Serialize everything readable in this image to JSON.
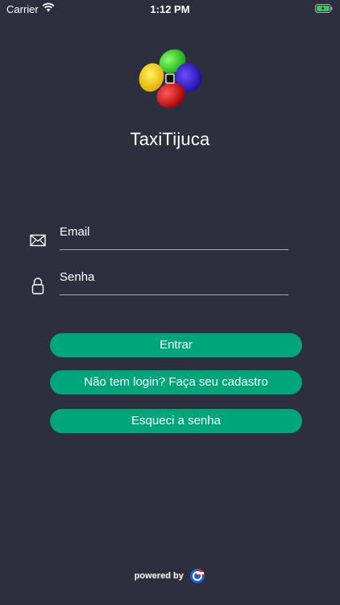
{
  "status_bar": {
    "carrier": "Carrier",
    "time": "1:12 PM",
    "icons": [
      "wifi-icon",
      "battery-charging-icon"
    ]
  },
  "app": {
    "title": "TaxiTijuca",
    "logo": "taxi-tijuca-logo"
  },
  "form": {
    "email_label": "Email",
    "email_icon": "envelope-icon",
    "password_label": "Senha",
    "password_icon": "lock-icon"
  },
  "buttons": {
    "login": "Entrar",
    "signup": "Não tem login? Faça seu cadastro",
    "forgot": "Esqueci a senha"
  },
  "footer": {
    "powered_by": "powered by",
    "brand_icon": "brand-logo-icon"
  },
  "colors": {
    "background": "#2d2f3e",
    "accent": "#00a67a",
    "text": "#ffffff",
    "underline": "#a9abb5"
  }
}
